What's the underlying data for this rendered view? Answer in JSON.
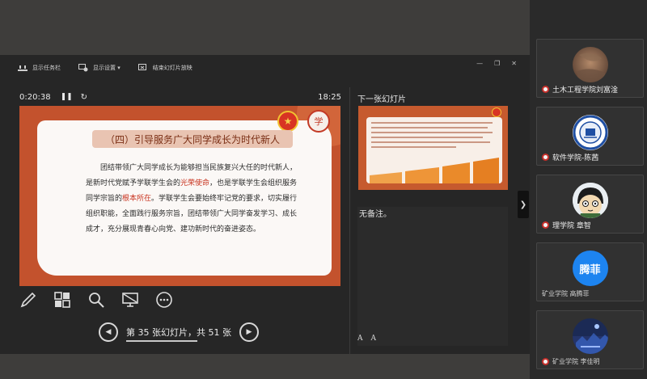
{
  "toolbar": {
    "show_taskbar": "显示任务栏",
    "display_settings": "显示设置 ▾",
    "end_show": "结束幻灯片放映"
  },
  "timer": {
    "elapsed": "0:20:38",
    "pause_icon": "❚❚",
    "reset_icon": "↻",
    "clock": "18:25"
  },
  "current_slide": {
    "heading": "（四）引导服务广大同学成长为时代新人",
    "body_parts": [
      "团结带领广大同学成长为能够担当民族复兴大任的时代新人，是新时代党赋予学联学生会的",
      "光荣使命",
      "，也是学联学生会组织服务同学宗旨的",
      "根本所在",
      "。学联学生会要始终牢记党的要求，切实履行组织职能，全面践行服务宗旨，团结带领广大同学奋发学习、成长成才，充分展现青春心向党、建功新时代的奋进姿态。"
    ],
    "logo_right_char": "学"
  },
  "slide_nav": {
    "prev_icon": "◀",
    "label": "第 35 张幻灯片，共 51 张",
    "next_icon": "▶"
  },
  "next_slide": {
    "title": "下一张幻灯片"
  },
  "notes": {
    "text": "无备注。",
    "font_larger": "A",
    "font_smaller": "A"
  },
  "side_handle": {
    "icon": "❯"
  },
  "participants": [
    {
      "name": "土木工程学院刘富淦",
      "avatar": "photo-brown"
    },
    {
      "name": "软件学院-陈茜",
      "avatar": "emblem"
    },
    {
      "name": "理学院 章智",
      "avatar": "cartoon"
    },
    {
      "name": "矿业学院 高腾菲",
      "avatar": "text",
      "avatar_text": "腾菲"
    },
    {
      "name": "矿业学院 李佳明",
      "avatar": "photo-night"
    }
  ],
  "colors": {
    "slide_frame": "#c3522d",
    "heading_bg": "#e9c4b2",
    "emphasis_red": "#c8321e",
    "gallery_bg": "#2a2a2a",
    "avatar_blue": "#1d84f0"
  }
}
